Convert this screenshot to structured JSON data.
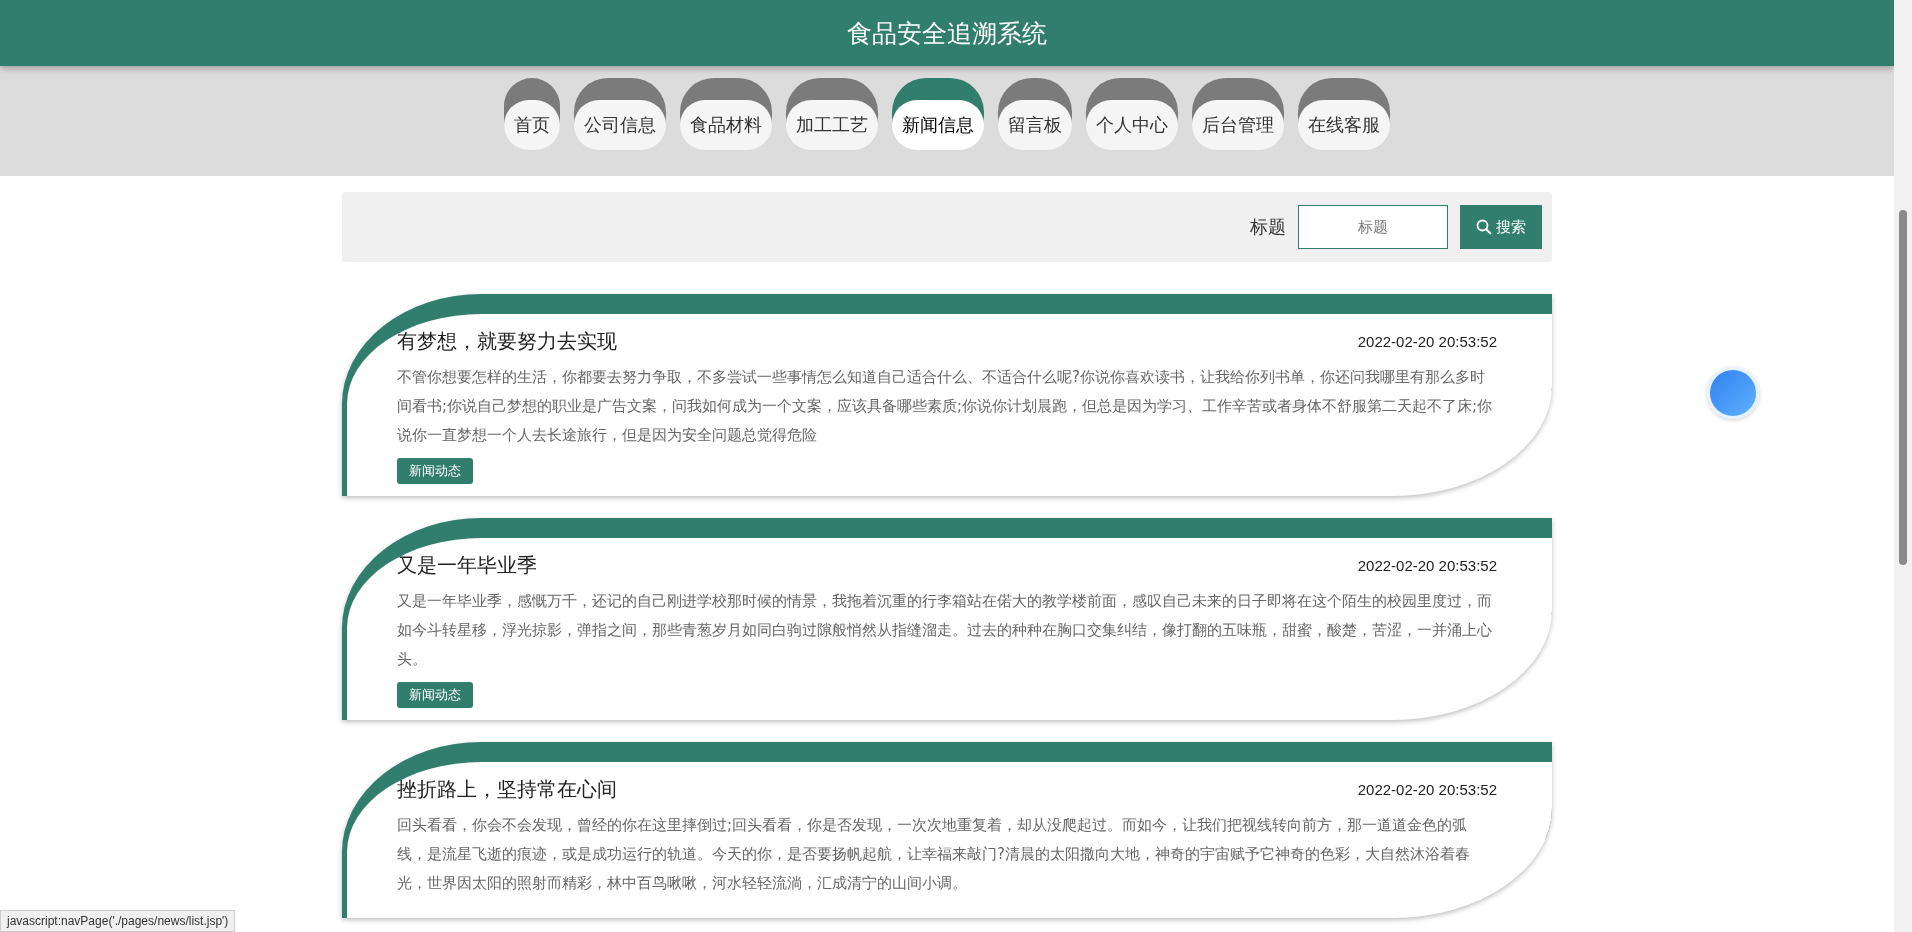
{
  "header": {
    "title": "食品安全追溯系统"
  },
  "nav": [
    {
      "label": "首页",
      "selected": false
    },
    {
      "label": "公司信息",
      "selected": false
    },
    {
      "label": "食品材料",
      "selected": false
    },
    {
      "label": "加工工艺",
      "selected": false
    },
    {
      "label": "新闻信息",
      "selected": true
    },
    {
      "label": "留言板",
      "selected": false
    },
    {
      "label": "个人中心",
      "selected": false
    },
    {
      "label": "后台管理",
      "selected": false
    },
    {
      "label": "在线客服",
      "selected": false
    }
  ],
  "search": {
    "label": "标题",
    "placeholder": "标题",
    "button": "搜索"
  },
  "news": [
    {
      "title": "有梦想，就要努力去实现",
      "time": "2022-02-20 20:53:52",
      "summary": "不管你想要怎样的生活，你都要去努力争取，不多尝试一些事情怎么知道自己适合什么、不适合什么呢?你说你喜欢读书，让我给你列书单，你还问我哪里有那么多时间看书;你说自己梦想的职业是广告文案，问我如何成为一个文案，应该具备哪些素质;你说你计划晨跑，但总是因为学习、工作辛苦或者身体不舒服第二天起不了床;你说你一直梦想一个人去长途旅行，但是因为安全问题总觉得危险",
      "tag": "新闻动态"
    },
    {
      "title": "又是一年毕业季",
      "time": "2022-02-20 20:53:52",
      "summary": "又是一年毕业季，感慨万千，还记的自己刚进学校那时候的情景，我拖着沉重的行李箱站在偌大的教学楼前面，感叹自己未来的日子即将在这个陌生的校园里度过，而如今斗转星移，浮光掠影，弹指之间，那些青葱岁月如同白驹过隙般悄然从指缝溜走。过去的种种在胸口交集纠结，像打翻的五味瓶，甜蜜，酸楚，苦涩，一并涌上心头。",
      "tag": "新闻动态"
    },
    {
      "title": "挫折路上，坚持常在心间",
      "time": "2022-02-20 20:53:52",
      "summary": "回头看看，你会不会发现，曾经的你在这里摔倒过;回头看看，你是否发现，一次次地重复着，却从没爬起过。而如今，让我们把视线转向前方，那一道道金色的弧线，是流星飞逝的痕迹，或是成功运行的轨道。今天的你，是否要扬帆起航，让幸福来敲门?清晨的太阳撒向大地，神奇的宇宙赋予它神奇的色彩，大自然沐浴着春光，世界因太阳的照射而精彩，林中百鸟啾啾，河水轻轻流淌，汇成清宁的山间小调。"
    }
  ],
  "status_bar": {
    "url": "javascript:navPage('./pages/news/list.jsp')"
  }
}
